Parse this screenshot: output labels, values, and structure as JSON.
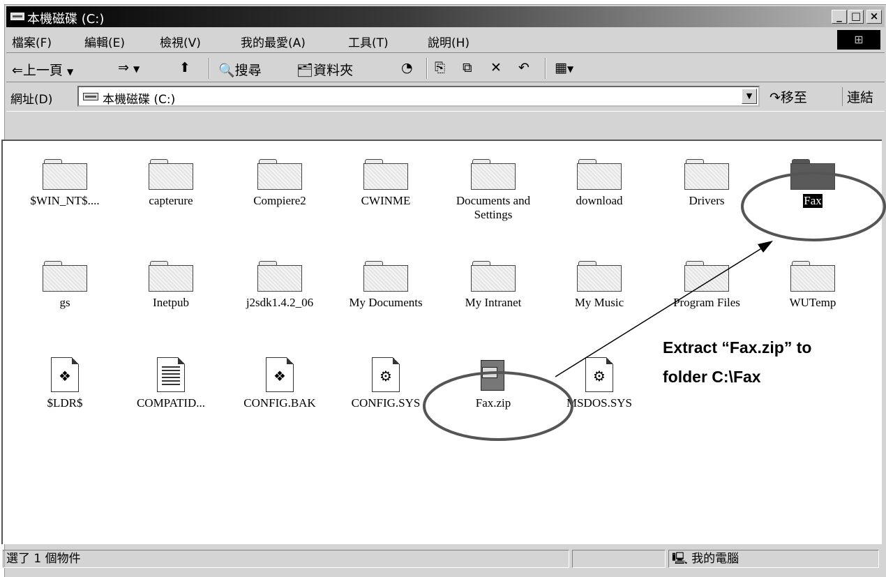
{
  "window": {
    "title": "本機磁碟 (C:)",
    "minimize": "_",
    "maximize": "□",
    "close": "×"
  },
  "menu": [
    "檔案(F)",
    "編輯(E)",
    "檢視(V)",
    "我的最愛(A)",
    "工具(T)",
    "說明(H)"
  ],
  "toolbar": {
    "back": "上一頁",
    "search": "搜尋",
    "folders": "資料夾"
  },
  "address": {
    "label": "網址(D)",
    "value": "本機磁碟 (C:)",
    "go": "移至",
    "links": "連結"
  },
  "items": [
    {
      "name": "$WIN_NT$....",
      "type": "folder"
    },
    {
      "name": "capterure",
      "type": "folder"
    },
    {
      "name": "Compiere2",
      "type": "folder"
    },
    {
      "name": "CWINME",
      "type": "folder"
    },
    {
      "name": "Documents and Settings",
      "type": "folder"
    },
    {
      "name": "download",
      "type": "folder"
    },
    {
      "name": "Drivers",
      "type": "folder"
    },
    {
      "name": "Fax",
      "type": "folder",
      "selected": true
    },
    {
      "name": "gs",
      "type": "folder"
    },
    {
      "name": "Inetpub",
      "type": "folder"
    },
    {
      "name": "j2sdk1.4.2_06",
      "type": "folder"
    },
    {
      "name": "My Documents",
      "type": "folder"
    },
    {
      "name": "My Intranet",
      "type": "folder"
    },
    {
      "name": "My Music",
      "type": "folder"
    },
    {
      "name": "Program Files",
      "type": "folder"
    },
    {
      "name": "WUTemp",
      "type": "folder"
    },
    {
      "name": "$LDR$",
      "type": "system-file"
    },
    {
      "name": "COMPATID...",
      "type": "text-file"
    },
    {
      "name": "CONFIG.BAK",
      "type": "system-file"
    },
    {
      "name": "CONFIG.SYS",
      "type": "gear-file"
    },
    {
      "name": "Fax.zip",
      "type": "zip"
    },
    {
      "name": "MSDOS.SYS",
      "type": "gear-file"
    }
  ],
  "annotation": {
    "line1": "Extract “Fax.zip” to",
    "line2": "folder C:\\Fax"
  },
  "status": {
    "selection": "選了 1 個物件",
    "location": "我的電腦"
  },
  "colors": {
    "selected_bg": "#000000",
    "selected_text": "#ffffff",
    "annotation": "#000000"
  }
}
